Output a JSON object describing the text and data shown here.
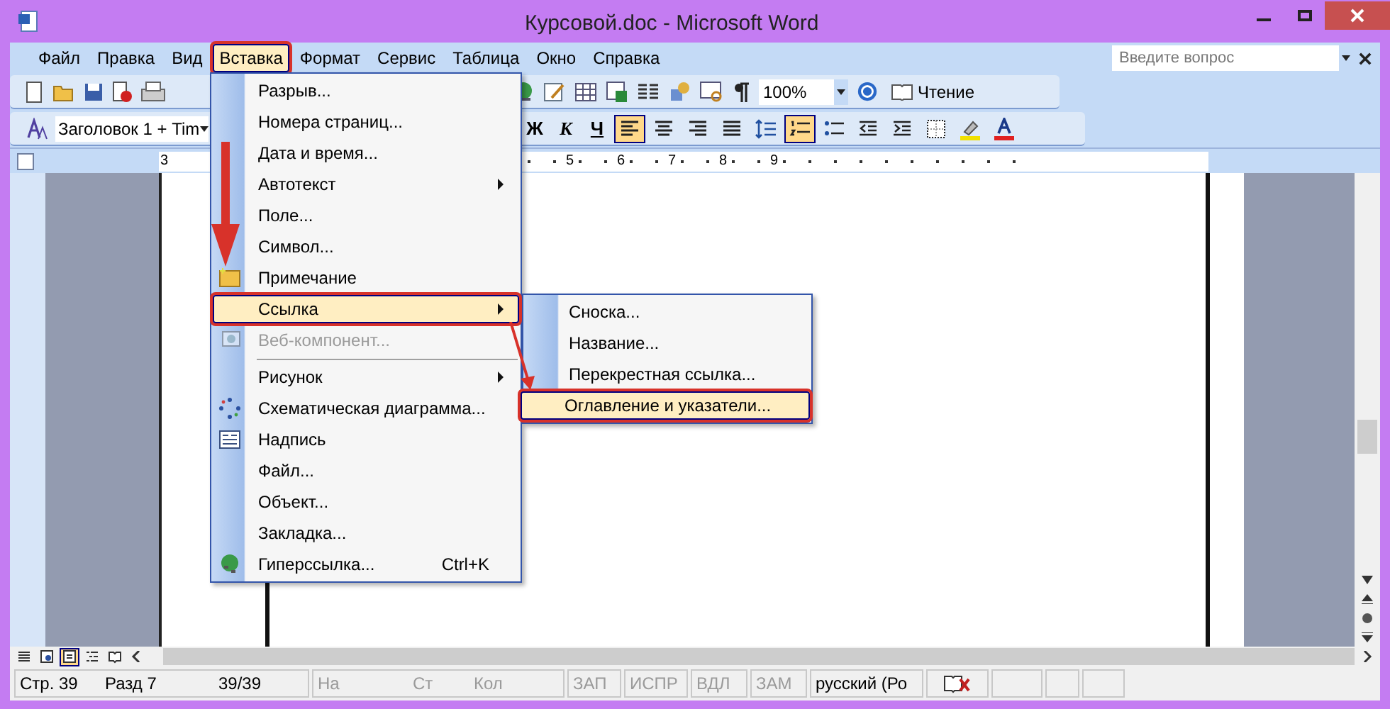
{
  "window": {
    "title": "Курсовой.doc - Microsoft Word"
  },
  "menu_bar": [
    {
      "label": "Файл",
      "selected": false
    },
    {
      "label": "Правка",
      "selected": false
    },
    {
      "label": "Вид",
      "selected": false
    },
    {
      "label": "Вставка",
      "selected": true
    },
    {
      "label": "Формат",
      "selected": false
    },
    {
      "label": "Сервис",
      "selected": false
    },
    {
      "label": "Таблица",
      "selected": false
    },
    {
      "label": "Окно",
      "selected": false
    },
    {
      "label": "Справка",
      "selected": false
    }
  ],
  "help_box": {
    "placeholder": "Введите вопрос"
  },
  "standard_toolbar": {
    "zoom": "100%",
    "reading_button": "Чтение"
  },
  "formatting_toolbar": {
    "style": "Заголовок 1 + Tim",
    "buttons": [
      {
        "kind": "bold",
        "label": "Ж",
        "selected": false
      },
      {
        "kind": "italic",
        "label": "К",
        "selected": false
      },
      {
        "kind": "underline",
        "label": "Ч",
        "selected": false
      },
      {
        "kind": "align-left",
        "selected": true
      },
      {
        "kind": "align-center",
        "selected": false
      },
      {
        "kind": "align-right",
        "selected": false
      },
      {
        "kind": "justify",
        "selected": false
      },
      {
        "kind": "line-spacing",
        "selected": false
      },
      {
        "kind": "numbering",
        "selected": true
      },
      {
        "kind": "bullets",
        "selected": false
      },
      {
        "kind": "outdent",
        "selected": false
      },
      {
        "kind": "indent",
        "selected": false
      },
      {
        "kind": "borders",
        "selected": false
      },
      {
        "kind": "highlight",
        "selected": false
      },
      {
        "kind": "font-color",
        "selected": false
      }
    ]
  },
  "ruler": {
    "left_label": "3",
    "labels": [
      "5",
      "6",
      "7",
      "8",
      "9"
    ]
  },
  "insert_menu": [
    {
      "label": "Разрыв...",
      "selected": false,
      "disabled": false
    },
    {
      "label": "Номера страниц...",
      "selected": false,
      "disabled": false
    },
    {
      "label": "Дата и время...",
      "selected": false,
      "disabled": false
    },
    {
      "label": "Автотекст",
      "selected": false,
      "disabled": false,
      "submenu": true
    },
    {
      "label": "Поле...",
      "selected": false,
      "disabled": false
    },
    {
      "label": "Символ...",
      "selected": false,
      "disabled": false
    },
    {
      "label": "Примечание",
      "selected": false,
      "disabled": false,
      "kind": "note"
    },
    {
      "label": "Ссылка",
      "selected": true,
      "disabled": false,
      "submenu": true
    },
    {
      "label": "Веб-компонент...",
      "selected": false,
      "disabled": true,
      "kind": "web"
    },
    {
      "label": "Рисунок",
      "selected": false,
      "disabled": false,
      "submenu": true,
      "separator_before": true
    },
    {
      "label": "Схематическая диаграмма...",
      "selected": false,
      "disabled": false,
      "kind": "diagram"
    },
    {
      "label": "Надпись",
      "selected": false,
      "disabled": false,
      "kind": "textbox"
    },
    {
      "label": "Файл...",
      "selected": false,
      "disabled": false
    },
    {
      "label": "Объект...",
      "selected": false,
      "disabled": false
    },
    {
      "label": "Закладка...",
      "selected": false,
      "disabled": false
    },
    {
      "label": "Гиперссылка...",
      "selected": false,
      "disabled": false,
      "kind": "hyperlink",
      "shortcut": "Ctrl+K"
    }
  ],
  "reference_submenu": [
    {
      "label": "Сноска...",
      "selected": false
    },
    {
      "label": "Название...",
      "selected": false
    },
    {
      "label": "Перекрестная ссылка...",
      "selected": false
    },
    {
      "label": "Оглавление и указатели...",
      "selected": true
    }
  ],
  "view_buttons": [
    {
      "kind": "normal",
      "selected": false
    },
    {
      "kind": "web",
      "selected": false
    },
    {
      "kind": "print",
      "selected": true
    },
    {
      "kind": "outline",
      "selected": false
    },
    {
      "kind": "reading",
      "selected": false
    }
  ],
  "status_bar": [
    {
      "label": "Стр. 39",
      "disabled": false
    },
    {
      "label": "Разд 7",
      "disabled": false
    },
    {
      "label": "39/39",
      "disabled": false
    },
    {
      "label": "На",
      "disabled": true
    },
    {
      "label": "Ст",
      "disabled": true
    },
    {
      "label": "Кол",
      "disabled": true
    },
    {
      "label": "ЗАП",
      "disabled": true
    },
    {
      "label": "ИСПР",
      "disabled": true
    },
    {
      "label": "ВДЛ",
      "disabled": true
    },
    {
      "label": "ЗАМ",
      "disabled": true
    },
    {
      "label": "русский (Ро",
      "disabled": false
    }
  ]
}
